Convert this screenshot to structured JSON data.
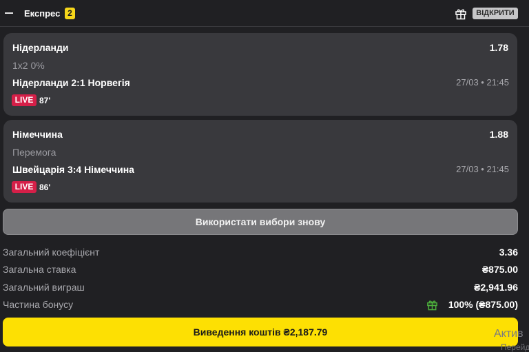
{
  "header": {
    "title": "Експрес",
    "count": "2",
    "open_label": "ВІДКРИТИ"
  },
  "bets": [
    {
      "team": "Нідерланди",
      "odds": "1.78",
      "market": "1x2 0%",
      "match": "Нідерланди 2:1 Норвегія",
      "datetime": "27/03 • 21:45",
      "live": "LIVE",
      "minute": "87'"
    },
    {
      "team": "Німеччина",
      "odds": "1.88",
      "market": "Перемога",
      "match": "Швейцарія 3:4 Німеччина",
      "datetime": "27/03 • 21:45",
      "live": "LIVE",
      "minute": "86'"
    }
  ],
  "reuse_button": "Використати вибори знову",
  "summary": {
    "total_odds_label": "Загальний коефіцієнт",
    "total_odds_value": "3.36",
    "total_stake_label": "Загальна ставка",
    "total_stake_value": "₴875.00",
    "total_win_label": "Загальний виграш",
    "total_win_value": "₴2,941.96",
    "bonus_label": "Частина бонусу",
    "bonus_value": "100% (₴875.00)"
  },
  "withdraw_button": "Виведення коштів ₴2,187.79",
  "watermark": {
    "line1": "Актив",
    "line2": "Перейд"
  },
  "colors": {
    "background": "#202023",
    "card": "#39393d",
    "accent_yellow": "#fde003",
    "live_red": "#d51f48",
    "bonus_green": "#4caf3c"
  },
  "icons": {
    "collapse": "minus-icon",
    "gift": "gift-icon",
    "bonus": "gift-icon-green"
  }
}
